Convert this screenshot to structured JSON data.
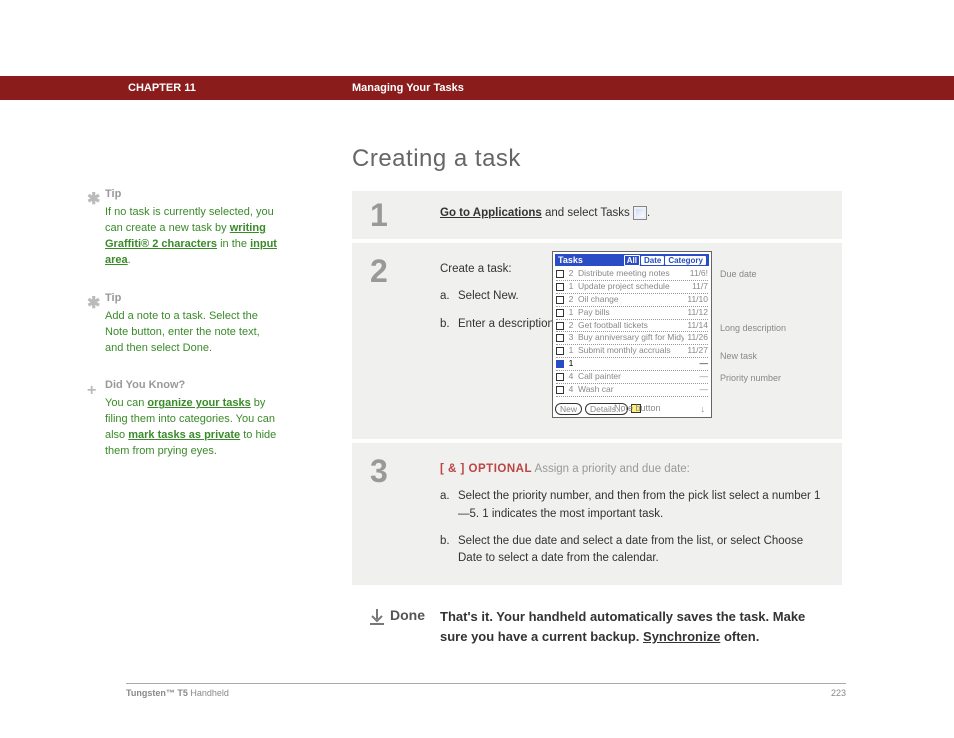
{
  "header": {
    "chapter": "CHAPTER 11",
    "section": "Managing Your Tasks"
  },
  "page_title": "Creating a task",
  "sidebar": {
    "tips": [
      {
        "icon": "asterisk",
        "title": "Tip",
        "body_parts": [
          {
            "t": "If no task is currently selected, you can create a new task by "
          },
          {
            "t": "writing Graffiti® 2 characters",
            "link": true
          },
          {
            "t": " in the "
          },
          {
            "t": "input area",
            "link": true
          },
          {
            "t": "."
          }
        ]
      },
      {
        "icon": "asterisk",
        "title": "Tip",
        "body_parts": [
          {
            "t": "Add a note to a task. Select the Note button, enter the note text, and then select Done."
          }
        ]
      },
      {
        "icon": "plus",
        "title": "Did You Know?",
        "body_parts": [
          {
            "t": "You can "
          },
          {
            "t": "organize your tasks",
            "link": true
          },
          {
            "t": " by filing them into categories. You can also "
          },
          {
            "t": "mark tasks as private",
            "link": true
          },
          {
            "t": " to hide them from prying eyes."
          }
        ]
      }
    ]
  },
  "steps": [
    {
      "num": "1",
      "body": {
        "link_text": "Go to Applications",
        "rest": " and select Tasks ",
        "show_icon": true,
        "tail": "."
      }
    },
    {
      "num": "2",
      "body": {
        "intro": "Create a task:",
        "subs": [
          {
            "letter": "a.",
            "text": "Select New."
          },
          {
            "letter": "b.",
            "text": "Enter a description of the task."
          }
        ]
      },
      "has_screenshot": true
    },
    {
      "num": "3",
      "body": {
        "optional_tag": "[ & ]  OPTIONAL",
        "optional_desc": "   Assign a priority and due date:",
        "subs": [
          {
            "letter": "a.",
            "text": "Select the priority number, and then from the pick list select a number 1—5. 1 indicates the most important task."
          },
          {
            "letter": "b.",
            "text": "Select the due date and select a date from the list, or select Choose Date to select a date from the calendar."
          }
        ]
      }
    }
  ],
  "done": {
    "label": "Done",
    "text_pre": "That's it. Your handheld automatically saves the task. Make sure you have a current backup. ",
    "link": "Synchronize",
    "text_post": " often."
  },
  "pda": {
    "title": "Tasks",
    "tabs": [
      "All",
      "Date",
      "Category"
    ],
    "rows": [
      {
        "prio": "2",
        "desc": "Distribute meeting notes",
        "date": "11/6!"
      },
      {
        "prio": "1",
        "desc": "Update project schedule",
        "date": "11/7"
      },
      {
        "prio": "2",
        "desc": "Oil change",
        "date": "11/10"
      },
      {
        "prio": "1",
        "desc": "Pay bills",
        "date": "11/12"
      },
      {
        "prio": "2",
        "desc": "Get football tickets",
        "date": "11/14"
      },
      {
        "prio": "3",
        "desc": "Buy anniversary gift for Midyne & Greg",
        "date": "11/26"
      },
      {
        "prio": "1",
        "desc": "Submit monthly accruals",
        "date": "11/27"
      },
      {
        "prio": "1",
        "desc": "",
        "date": "—",
        "selected": true
      },
      {
        "prio": "4",
        "desc": "Call painter",
        "date": "—"
      },
      {
        "prio": "4",
        "desc": "Wash car",
        "date": "—"
      }
    ],
    "buttons": {
      "new": "New",
      "details": "Details..."
    },
    "callouts": {
      "due": "Due date",
      "long": "Long description",
      "newtask": "New task",
      "priority": "Priority number",
      "note": "Note button"
    }
  },
  "footer": {
    "product_bold": "Tungsten™ T5",
    "product_rest": " Handheld",
    "page": "223"
  }
}
